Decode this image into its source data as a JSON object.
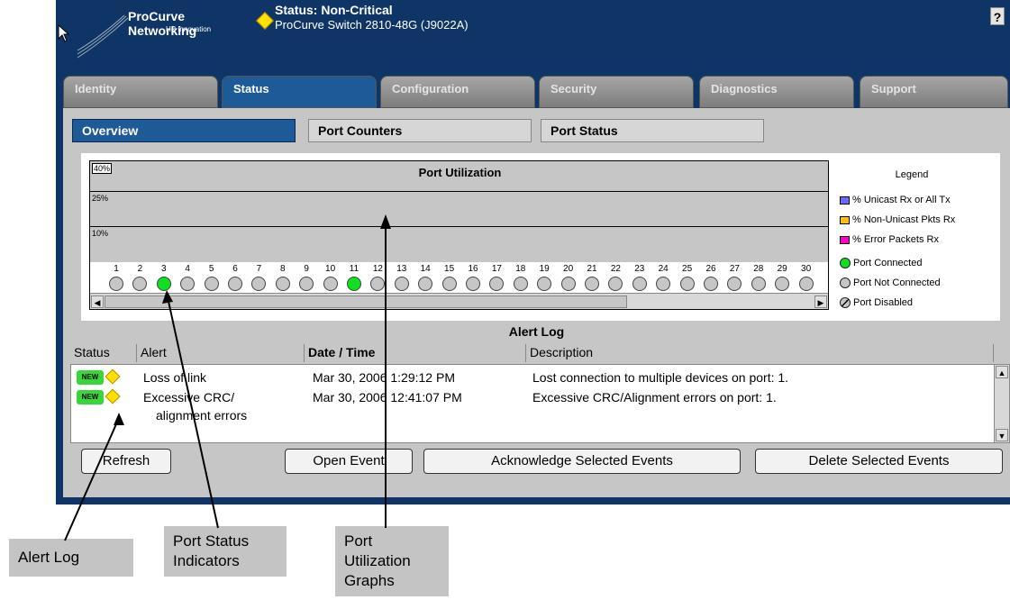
{
  "window": {
    "brand": "ProCurve Networking",
    "brand_sub": "HP Innovation",
    "status_title": "Status: Non-Critical",
    "model": "ProCurve Switch 2810-48G (J9022A)",
    "help_label": "?"
  },
  "tabs": [
    {
      "label": "Identity"
    },
    {
      "label": "Status"
    },
    {
      "label": "Configuration"
    },
    {
      "label": "Security"
    },
    {
      "label": "Diagnostics"
    },
    {
      "label": "Support"
    }
  ],
  "subtabs": [
    {
      "label": "Overview"
    },
    {
      "label": "Port Counters"
    },
    {
      "label": "Port Status"
    }
  ],
  "graph": {
    "title": "Port Utilization",
    "levels": [
      "40%",
      "25%",
      "10%"
    ],
    "ports": [
      "1",
      "2",
      "3",
      "4",
      "5",
      "6",
      "7",
      "8",
      "9",
      "10",
      "11",
      "12",
      "13",
      "14",
      "15",
      "16",
      "17",
      "18",
      "19",
      "20",
      "21",
      "22",
      "23",
      "24",
      "25",
      "26",
      "27",
      "28",
      "29",
      "30"
    ],
    "connected_ports": [
      3,
      11
    ]
  },
  "legend": {
    "title": "Legend",
    "items": [
      {
        "label": "% Unicast Rx or All Tx",
        "color": "#6a6aff"
      },
      {
        "label": "% Non-Unicast Pkts Rx",
        "color": "#ffc000"
      },
      {
        "label": "% Error Packets Rx",
        "color": "#ff00c8"
      }
    ],
    "port_states": [
      {
        "label": "Port Connected",
        "icon": "green-circle"
      },
      {
        "label": "Port Not Connected",
        "icon": "gray-circle"
      },
      {
        "label": "Port Disabled",
        "icon": "struck-circle"
      }
    ]
  },
  "alert_log": {
    "title": "Alert Log",
    "columns": [
      "Status",
      "Alert",
      "Date / Time",
      "Description"
    ],
    "rows": [
      {
        "badge": "NEW",
        "alert": "Loss of link",
        "date": "Mar 30, 2006 1:29:12 PM",
        "description": "Lost connection to multiple devices on port: 1."
      },
      {
        "badge": "NEW",
        "alert": "Excessive CRC/",
        "alert_line2": "alignment errors",
        "date": "Mar 30, 2006 12:41:07 PM",
        "description": "Excessive CRC/Alignment errors on port: 1."
      }
    ]
  },
  "buttons": {
    "refresh": "Refresh",
    "open_event": "Open Event",
    "acknowledge": "Acknowledge Selected Events",
    "delete": "Delete Selected Events"
  },
  "callouts": {
    "alert_log": "Alert Log",
    "port_status_line1": "Port Status",
    "port_status_line2": "Indicators",
    "port_util_line1": "Port",
    "port_util_line2": "Utilization",
    "port_util_line3": "Graphs"
  }
}
